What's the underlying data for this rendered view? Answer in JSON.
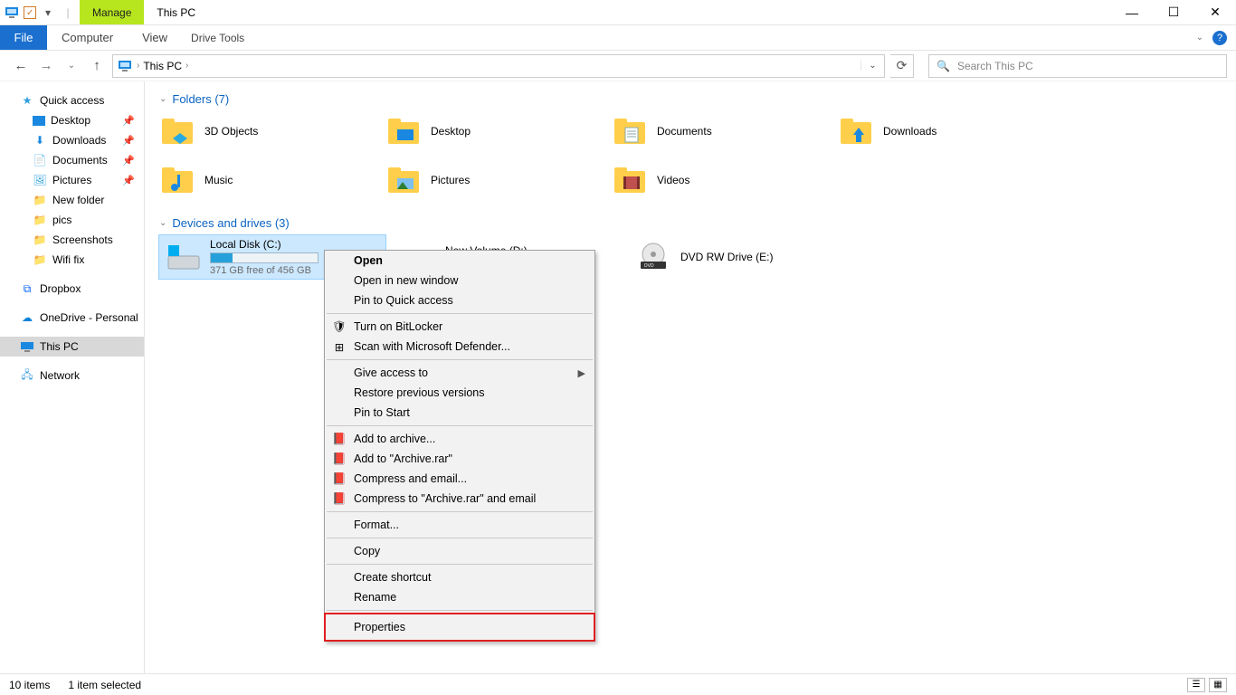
{
  "window": {
    "title": "This PC",
    "toolTab": "Manage",
    "toolSub": "Drive Tools"
  },
  "ribbon": {
    "file": "File",
    "computer": "Computer",
    "view": "View",
    "driveTools": "Drive Tools"
  },
  "address": {
    "location": "This PC",
    "searchPlaceholder": "Search This PC"
  },
  "sidebar": {
    "quickAccess": "Quick access",
    "items": [
      {
        "label": "Desktop",
        "pin": true
      },
      {
        "label": "Downloads",
        "pin": true
      },
      {
        "label": "Documents",
        "pin": true
      },
      {
        "label": "Pictures",
        "pin": true
      },
      {
        "label": "New folder",
        "pin": false
      },
      {
        "label": "pics",
        "pin": false
      },
      {
        "label": "Screenshots",
        "pin": false
      },
      {
        "label": "Wifi fix",
        "pin": false
      }
    ],
    "dropbox": "Dropbox",
    "onedrive": "OneDrive - Personal",
    "thispc": "This PC",
    "network": "Network"
  },
  "groups": {
    "foldersHeader": "Folders (7)",
    "folders": [
      "3D Objects",
      "Desktop",
      "Documents",
      "Downloads",
      "Music",
      "Pictures",
      "Videos"
    ],
    "drivesHeader": "Devices and drives (3)",
    "drives": [
      {
        "name": "Local Disk (C:)",
        "sub": "371 GB free of 456 GB",
        "selected": true,
        "hasBar": true
      },
      {
        "name": "New Volume (D:)",
        "selected": false,
        "hasBar": true
      },
      {
        "name": "DVD RW Drive (E:)",
        "selected": false,
        "hasBar": false
      }
    ]
  },
  "context": [
    {
      "label": "Open",
      "bold": true
    },
    {
      "label": "Open in new window"
    },
    {
      "label": "Pin to Quick access"
    },
    {
      "sep": true
    },
    {
      "label": "Turn on BitLocker",
      "icon": "shield"
    },
    {
      "label": "Scan with Microsoft Defender...",
      "icon": "defender"
    },
    {
      "sep": true
    },
    {
      "label": "Give access to",
      "submenu": true
    },
    {
      "label": "Restore previous versions"
    },
    {
      "label": "Pin to Start"
    },
    {
      "sep": true
    },
    {
      "label": "Add to archive...",
      "icon": "rar"
    },
    {
      "label": "Add to \"Archive.rar\"",
      "icon": "rar"
    },
    {
      "label": "Compress and email...",
      "icon": "rar"
    },
    {
      "label": "Compress to \"Archive.rar\" and email",
      "icon": "rar"
    },
    {
      "sep": true
    },
    {
      "label": "Format..."
    },
    {
      "sep": true
    },
    {
      "label": "Copy"
    },
    {
      "sep": true
    },
    {
      "label": "Create shortcut"
    },
    {
      "label": "Rename"
    },
    {
      "sep": true
    },
    {
      "label": "Properties",
      "highlight": true
    }
  ],
  "status": {
    "items": "10 items",
    "selected": "1 item selected"
  }
}
